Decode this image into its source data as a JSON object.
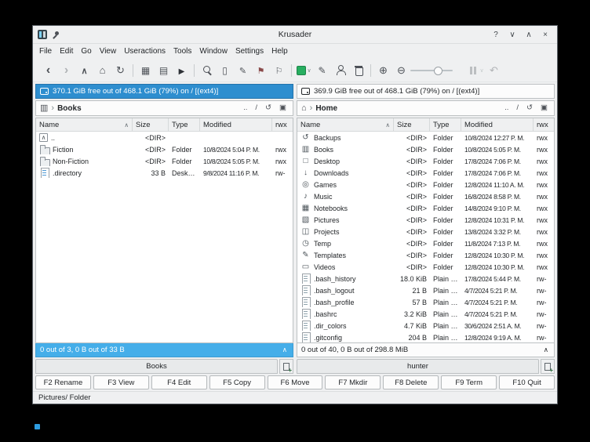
{
  "window": {
    "title": "Krusader",
    "buttons": [
      "?",
      "∨",
      "∧",
      "×"
    ]
  },
  "menu": [
    "File",
    "Edit",
    "Go",
    "View",
    "Useractions",
    "Tools",
    "Window",
    "Settings",
    "Help"
  ],
  "toolbar": {
    "items": [
      {
        "icon": "back-icon",
        "extra": ""
      },
      {
        "icon": "forward-icon",
        "extra": "disabled"
      },
      {
        "icon": "up-icon",
        "extra": ""
      },
      {
        "icon": "home-icon",
        "extra": ""
      },
      {
        "icon": "reload-icon",
        "extra": ""
      },
      {
        "icon": "separator-icon",
        "extra": "sep"
      },
      {
        "icon": "compare-directories-icon",
        "extra": ""
      },
      {
        "icon": "swap-panels-icon",
        "extra": ""
      },
      {
        "icon": "start-icon",
        "extra": ""
      },
      {
        "icon": "separator-icon",
        "extra": "sep"
      },
      {
        "icon": "find-icon",
        "extra": ""
      },
      {
        "icon": "view-file-icon",
        "extra": ""
      },
      {
        "icon": "edit-file-icon",
        "extra": ""
      },
      {
        "icon": "bookmark-icon",
        "extra": ""
      },
      {
        "icon": "flag-icon",
        "extra": ""
      },
      {
        "icon": "separator-icon",
        "extra": "sep"
      },
      {
        "icon": "archive-icon",
        "extra": "dropdown"
      },
      {
        "icon": "pencil-icon",
        "extra": ""
      },
      {
        "icon": "user-icon",
        "extra": ""
      },
      {
        "icon": "trash-icon",
        "extra": ""
      },
      {
        "icon": "separator-icon",
        "extra": "sep"
      },
      {
        "icon": "zoom-in-icon",
        "extra": ""
      },
      {
        "icon": "zoom-out-icon",
        "extra": ""
      },
      {
        "icon": "zoom-slider",
        "extra": ""
      },
      {
        "icon": "pause-icon",
        "extra": "disabled dropdown spacer"
      },
      {
        "icon": "undo-icon",
        "extra": "disabled"
      }
    ]
  },
  "panels": {
    "left": {
      "media_info": "370.1 GiB free out of 468.1 GiB (79%) on / [(ext4)]",
      "breadcrumb": "Books",
      "tools": {
        "up": "..",
        "root": "/"
      },
      "columns": [
        {
          "label": "Name",
          "sort": "∧"
        },
        {
          "label": "Size",
          "sort": ""
        },
        {
          "label": "Type",
          "sort": ""
        },
        {
          "label": "Modified",
          "sort": ""
        },
        {
          "label": "rwx",
          "sort": ""
        }
      ],
      "rows": [
        {
          "icon": "updir-icon",
          "name": "..",
          "size": "<DIR>",
          "type": "",
          "modified": "",
          "rwx": ""
        },
        {
          "icon": "folder-icon",
          "name": "Fiction",
          "size": "<DIR>",
          "type": "Folder",
          "modified": "10/8/2024 5:04 P. M.",
          "rwx": "rwx"
        },
        {
          "icon": "folder-icon",
          "name": "Non-Fiction",
          "size": "<DIR>",
          "type": "Folder",
          "modified": "10/8/2024 5:05 P. M.",
          "rwx": "rwx"
        },
        {
          "icon": "desktop-entry-icon",
          "name": ".directory",
          "size": "33 B",
          "type": "Desktop en…",
          "modified": "9/8/2024 11:16 P. M.",
          "rwx": "rw-"
        }
      ],
      "status": "0 out of 3, 0 B out of 33 B",
      "collapse": "∧",
      "tab": "Books"
    },
    "right": {
      "media_info": "369.9 GiB free out of 468.1 GiB (79%) on / [(ext4)]",
      "breadcrumb": "Home",
      "tools": {
        "up": "..",
        "root": "/"
      },
      "columns": [
        {
          "label": "Name",
          "sort": "∧"
        },
        {
          "label": "Size",
          "sort": ""
        },
        {
          "label": "Type",
          "sort": ""
        },
        {
          "label": "Modified",
          "sort": ""
        },
        {
          "label": "rwx",
          "sort": ""
        }
      ],
      "rows": [
        {
          "icon": "backups-folder-icon",
          "name": "Backups",
          "size": "<DIR>",
          "type": "Folder",
          "modified": "10/8/2024 12:27 P. M.",
          "rwx": "rwx"
        },
        {
          "icon": "books-folder-icon",
          "name": "Books",
          "size": "<DIR>",
          "type": "Folder",
          "modified": "10/8/2024 5:05 P. M.",
          "rwx": "rwx"
        },
        {
          "icon": "desktop-folder-icon",
          "name": "Desktop",
          "size": "<DIR>",
          "type": "Folder",
          "modified": "17/8/2024 7:06 P. M.",
          "rwx": "rwx"
        },
        {
          "icon": "downloads-folder-icon",
          "name": "Downloads",
          "size": "<DIR>",
          "type": "Folder",
          "modified": "17/8/2024 7:06 P. M.",
          "rwx": "rwx"
        },
        {
          "icon": "games-folder-icon",
          "name": "Games",
          "size": "<DIR>",
          "type": "Folder",
          "modified": "12/8/2024 11:10 A. M.",
          "rwx": "rwx"
        },
        {
          "icon": "music-folder-icon",
          "name": "Music",
          "size": "<DIR>",
          "type": "Folder",
          "modified": "16/8/2024 8:58 P. M.",
          "rwx": "rwx"
        },
        {
          "icon": "notebooks-folder-icon",
          "name": "Notebooks",
          "size": "<DIR>",
          "type": "Folder",
          "modified": "14/8/2024 9:10 P. M.",
          "rwx": "rwx"
        },
        {
          "icon": "pictures-folder-icon",
          "name": "Pictures",
          "size": "<DIR>",
          "type": "Folder",
          "modified": "12/8/2024 10:31 P. M.",
          "rwx": "rwx"
        },
        {
          "icon": "projects-folder-icon",
          "name": "Projects",
          "size": "<DIR>",
          "type": "Folder",
          "modified": "13/8/2024 3:32 P. M.",
          "rwx": "rwx"
        },
        {
          "icon": "temp-folder-icon",
          "name": "Temp",
          "size": "<DIR>",
          "type": "Folder",
          "modified": "11/8/2024 7:13 P. M.",
          "rwx": "rwx"
        },
        {
          "icon": "templates-folder-icon",
          "name": "Templates",
          "size": "<DIR>",
          "type": "Folder",
          "modified": "12/8/2024 10:30 P. M.",
          "rwx": "rwx"
        },
        {
          "icon": "videos-folder-icon",
          "name": "Videos",
          "size": "<DIR>",
          "type": "Folder",
          "modified": "12/8/2024 10:30 P. M.",
          "rwx": "rwx"
        },
        {
          "icon": "text-file-icon",
          "name": ".bash_history",
          "size": "18.0 KiB",
          "type": "Plain t…",
          "modified": "17/8/2024 5:44 P. M.",
          "rwx": "rw-"
        },
        {
          "icon": "text-file-icon",
          "name": ".bash_logout",
          "size": "21 B",
          "type": "Plain t…",
          "modified": "4/7/2024 5:21 P. M.",
          "rwx": "rw-"
        },
        {
          "icon": "text-file-icon",
          "name": ".bash_profile",
          "size": "57 B",
          "type": "Plain t…",
          "modified": "4/7/2024 5:21 P. M.",
          "rwx": "rw-"
        },
        {
          "icon": "text-file-icon",
          "name": ".bashrc",
          "size": "3.2 KiB",
          "type": "Plain t…",
          "modified": "4/7/2024 5:21 P. M.",
          "rwx": "rw-"
        },
        {
          "icon": "text-file-icon",
          "name": ".dir_colors",
          "size": "4.7 KiB",
          "type": "Plain t…",
          "modified": "30/6/2024 2:51 A. M.",
          "rwx": "rw-"
        },
        {
          "icon": "text-file-icon",
          "name": ".gitconfig",
          "size": "204 B",
          "type": "Plain t…",
          "modified": "12/8/2024 9:19 A. M.",
          "rwx": "rw-"
        }
      ],
      "status": "0 out of 40, 0 B out of 298.8 MiB",
      "collapse": "∧",
      "tab": "hunter"
    }
  },
  "fn_buttons": [
    "F2 Rename",
    "F3 View",
    "F4 Edit",
    "F5 Copy",
    "F6 Move",
    "F7 Mkdir",
    "F8 Delete",
    "F9 Term",
    "F10 Quit"
  ],
  "statusbar": "Pictures/ Folder"
}
